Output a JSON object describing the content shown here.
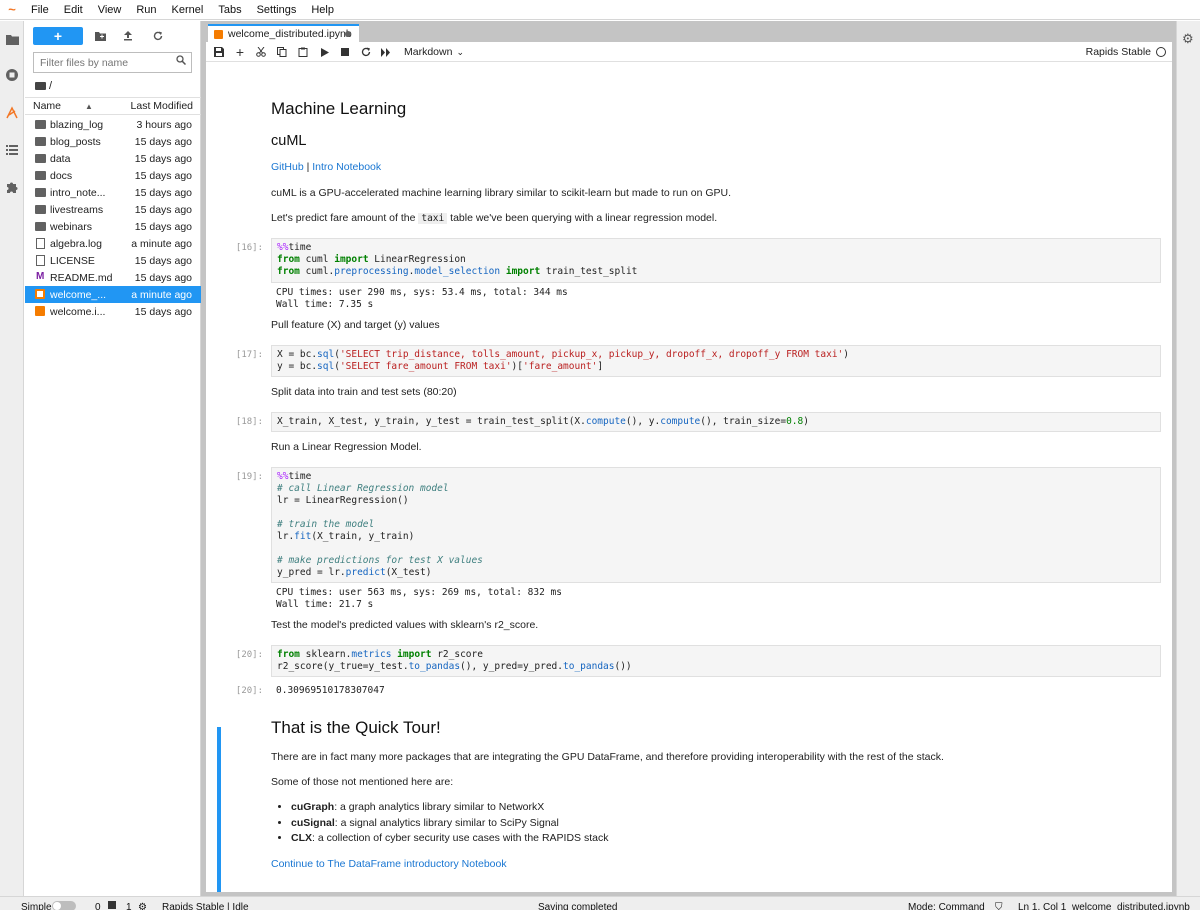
{
  "menubar": {
    "items": [
      "File",
      "Edit",
      "View",
      "Run",
      "Kernel",
      "Tabs",
      "Settings",
      "Help"
    ]
  },
  "filebrowser": {
    "new_label": "+",
    "filter_placeholder": "Filter files by name",
    "path": "/",
    "col_name": "Name",
    "col_modified": "Last Modified",
    "files": [
      {
        "name": "blazing_log",
        "modified": "3 hours ago",
        "type": "folder"
      },
      {
        "name": "blog_posts",
        "modified": "15 days ago",
        "type": "folder"
      },
      {
        "name": "data",
        "modified": "15 days ago",
        "type": "folder"
      },
      {
        "name": "docs",
        "modified": "15 days ago",
        "type": "folder"
      },
      {
        "name": "intro_note...",
        "modified": "15 days ago",
        "type": "folder"
      },
      {
        "name": "livestreams",
        "modified": "15 days ago",
        "type": "folder"
      },
      {
        "name": "webinars",
        "modified": "15 days ago",
        "type": "folder"
      },
      {
        "name": "algebra.log",
        "modified": "a minute ago",
        "type": "file"
      },
      {
        "name": "LICENSE",
        "modified": "15 days ago",
        "type": "file"
      },
      {
        "name": "README.md",
        "modified": "15 days ago",
        "type": "md"
      },
      {
        "name": "welcome_...",
        "modified": "a minute ago",
        "type": "notebook",
        "selected": true
      },
      {
        "name": "welcome.i...",
        "modified": "15 days ago",
        "type": "notebook"
      }
    ]
  },
  "tab": {
    "title": "welcome_distributed.ipynb"
  },
  "toolbar": {
    "cell_type": "Markdown",
    "kernel": "Rapids Stable"
  },
  "notebook": {
    "h1_ml": "Machine Learning",
    "h2_cuml": "cuML",
    "link_github": "GitHub",
    "link_sep": " | ",
    "link_intro": "Intro Notebook",
    "p_cuml_desc": "cuML is a GPU-accelerated machine learning library similar to scikit-learn but made to run on GPU.",
    "p_predict_a": "Let's predict fare amount of the ",
    "p_predict_code": "taxi",
    "p_predict_b": " table we've been querying with a linear regression model.",
    "prompt16": "[16]:",
    "out16": "CPU times: user 290 ms, sys: 53.4 ms, total: 344 ms\nWall time: 7.35 s",
    "p_pull": "Pull feature (X) and target (y) values",
    "prompt17": "[17]:",
    "p_split": "Split data into train and test sets (80:20)",
    "prompt18": "[18]:",
    "p_run": "Run a Linear Regression Model.",
    "prompt19": "[19]:",
    "out19": "CPU times: user 563 ms, sys: 269 ms, total: 832 ms\nWall time: 21.7 s",
    "p_test": "Test the model's predicted values with sklearn's r2_score.",
    "prompt20": "[20]:",
    "prompt20out": "[20]:",
    "out20": "0.30969510178307047",
    "h1_tour": "That is the Quick Tour!",
    "p_packages": "There are in fact many more packages that are integrating the GPU DataFrame, and therefore providing interoperability with the rest of the stack.",
    "p_some": "Some of those not mentioned here are:",
    "bullets": [
      {
        "bold": "cuGraph",
        "text": ": a graph analytics library similar to NetworkX"
      },
      {
        "bold": "cuSignal",
        "text": ": a signal analytics library similar to SciPy Signal"
      },
      {
        "bold": "CLX",
        "text": ": a collection of cyber security use cases with the RAPIDS stack"
      }
    ],
    "link_continue": "Continue to The DataFrame introductory Notebook"
  },
  "statusbar": {
    "mode_simple": "Simple",
    "terminals": "0",
    "kernels": "1",
    "kernel_status": "Rapids Stable | Idle",
    "saving": "Saving completed",
    "mode": "Mode: Command",
    "position": "Ln 1, Col 1",
    "filename": "welcome_distributed.ipynb"
  },
  "colors": {
    "accent": "#2196f3",
    "notebook_icon": "#f57c00",
    "link": "#1976d2"
  }
}
